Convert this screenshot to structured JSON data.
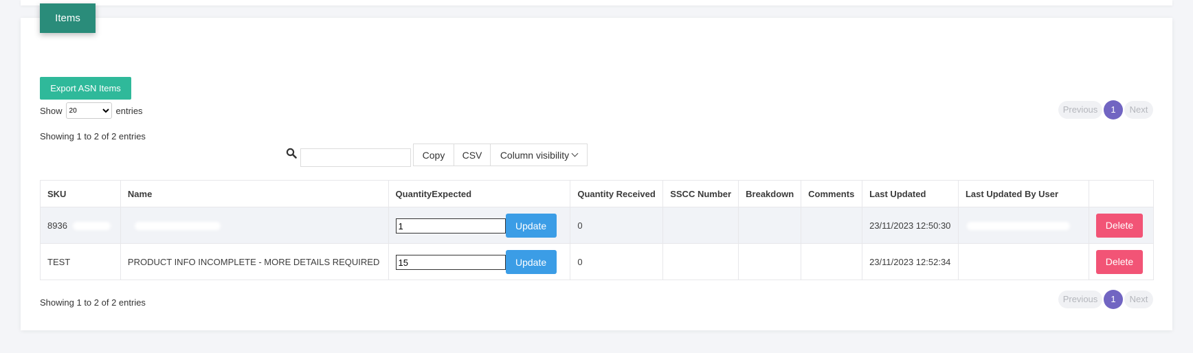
{
  "panel": {
    "tab_label": "Items"
  },
  "toolbar": {
    "export_label": "Export ASN Items"
  },
  "length_menu": {
    "show_label": "Show",
    "selected": "20",
    "entries_label": "entries"
  },
  "info": {
    "top": "Showing 1 to 2 of 2 entries",
    "bottom": "Showing 1 to 2 of 2 entries"
  },
  "pagination": {
    "previous": "Previous",
    "current": "1",
    "next": "Next"
  },
  "search": {
    "value": ""
  },
  "buttons": {
    "copy": "Copy",
    "csv": "CSV",
    "column_visibility": "Column visibility"
  },
  "table": {
    "headers": [
      "SKU",
      "Name",
      "QuantityExpected",
      "Quantity Received",
      "SSCC Number",
      "Breakdown",
      "Comments",
      "Last Updated",
      "Last Updated By User",
      ""
    ],
    "update_label": "Update",
    "delete_label": "Delete",
    "rows": [
      {
        "sku": "8936",
        "name": "",
        "qty_expected": "1",
        "qty_received": "0",
        "sscc": "",
        "breakdown": "",
        "comments": "",
        "last_updated": "23/11/2023 12:50:30",
        "user": ""
      },
      {
        "sku": "TEST",
        "name": "PRODUCT INFO INCOMPLETE - MORE DETAILS REQUIRED",
        "qty_expected": "15",
        "qty_received": "0",
        "sscc": "",
        "breakdown": "",
        "comments": "",
        "last_updated": "23/11/2023 12:52:34",
        "user": ""
      }
    ]
  },
  "colors": {
    "tab": "#2a8c7a",
    "export": "#2fb99a",
    "update": "#3b9de6",
    "delete": "#f25476",
    "page_active": "#7165c2"
  }
}
